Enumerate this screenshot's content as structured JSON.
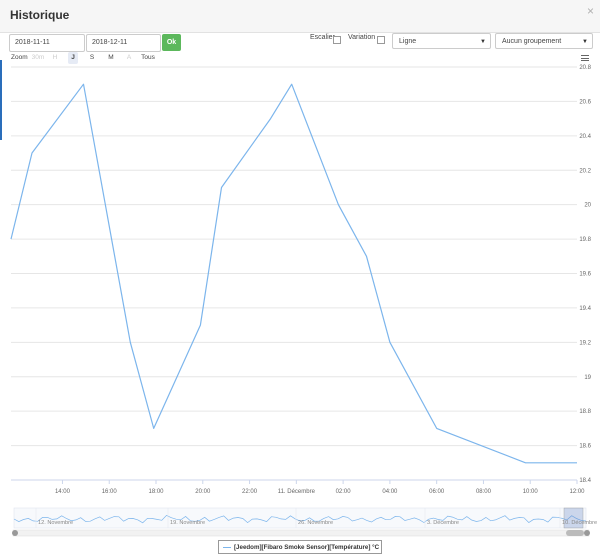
{
  "window": {
    "title": "Historique",
    "close_glyph": "×"
  },
  "filters": {
    "start_date": "2018-11-11",
    "end_date": "2018-12-11",
    "ok_label": "Ok",
    "escalier_label": "Escalier",
    "variation_label": "Variation",
    "chart_type_select": "Ligne",
    "grouping_select": "Aucun groupement"
  },
  "zoom": {
    "label": "Zoom",
    "buttons": [
      {
        "label": "30m",
        "state": "disabled"
      },
      {
        "label": "H",
        "state": "disabled"
      },
      {
        "label": "J",
        "state": "active"
      },
      {
        "label": "S",
        "state": "normal"
      },
      {
        "label": "M",
        "state": "normal"
      },
      {
        "label": "A",
        "state": "disabled"
      },
      {
        "label": "Tous",
        "state": "normal"
      }
    ]
  },
  "chart_data": {
    "type": "line",
    "title": "",
    "xlabel": "",
    "ylabel": "",
    "x_ticks": [
      "14:00",
      "16:00",
      "18:00",
      "20:00",
      "22:00",
      "11. Décembre",
      "02:00",
      "04:00",
      "06:00",
      "08:00",
      "10:00",
      "12:00"
    ],
    "x_hours": [
      14,
      16,
      18,
      20,
      22,
      24,
      26,
      28,
      30,
      32,
      34,
      36
    ],
    "xlim_hours": [
      11.8,
      36
    ],
    "y_ticks": [
      "18.4",
      "18.6",
      "18.8",
      "19",
      "19.2",
      "19.4",
      "19.6",
      "19.8",
      "20",
      "20.2",
      "20.4",
      "20.6",
      "20.8"
    ],
    "ylim": [
      18.4,
      20.8
    ],
    "grid": "horizontal",
    "series": [
      {
        "name": "[Jeedom][Fibaro Smoke Sensor][Température] °C",
        "color": "#7cb5ec",
        "x_hours": [
          11.8,
          12.7,
          14.9,
          16.9,
          17.9,
          19.9,
          20.8,
          22.9,
          23.8,
          25.8,
          27.0,
          28.0,
          30.0,
          33.8,
          36.0
        ],
        "y": [
          19.8,
          20.3,
          20.7,
          19.2,
          18.7,
          19.3,
          20.1,
          20.5,
          20.7,
          20.0,
          19.7,
          19.2,
          18.7,
          18.5,
          18.5
        ]
      }
    ],
    "navigator": {
      "ticks": [
        "12. Novembre",
        "19. Novembre",
        "26. Novembre",
        "3. Décembre",
        "10. Décembre"
      ],
      "selected_range": [
        "10. Décembre",
        "11. Décembre"
      ]
    },
    "legend_position": "bottom-center"
  }
}
